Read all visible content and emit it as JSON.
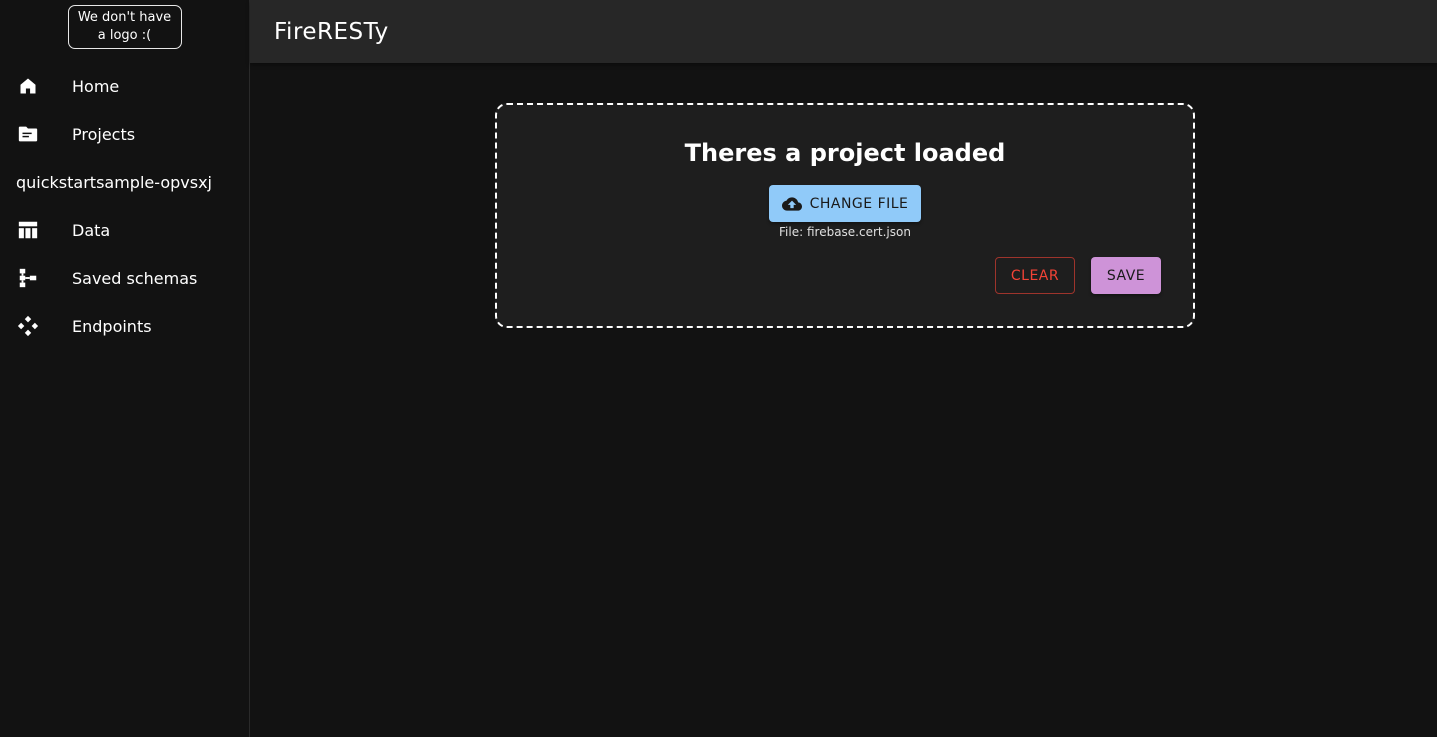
{
  "logo": {
    "line1": "We don't have",
    "line2": "a logo :("
  },
  "app": {
    "title": "FireRESTy"
  },
  "sidebar": {
    "items": [
      {
        "label": "Home",
        "icon": "home-icon"
      },
      {
        "label": "Projects",
        "icon": "folder-icon"
      }
    ],
    "project_name": "quickstartsample-opvsxj",
    "project_items": [
      {
        "label": "Data",
        "icon": "table-icon"
      },
      {
        "label": "Saved schemas",
        "icon": "schema-icon"
      },
      {
        "label": "Endpoints",
        "icon": "endpoints-icon"
      }
    ]
  },
  "main": {
    "card_title": "Theres a project loaded",
    "change_file_label": "CHANGE FILE",
    "file_text": "File: firebase.cert.json",
    "clear_label": "CLEAR",
    "save_label": "SAVE"
  },
  "colors": {
    "background": "#121212",
    "topbar": "#272727",
    "primary": "#90caf9",
    "secondary": "#ce93d8",
    "error": "#f44336"
  }
}
